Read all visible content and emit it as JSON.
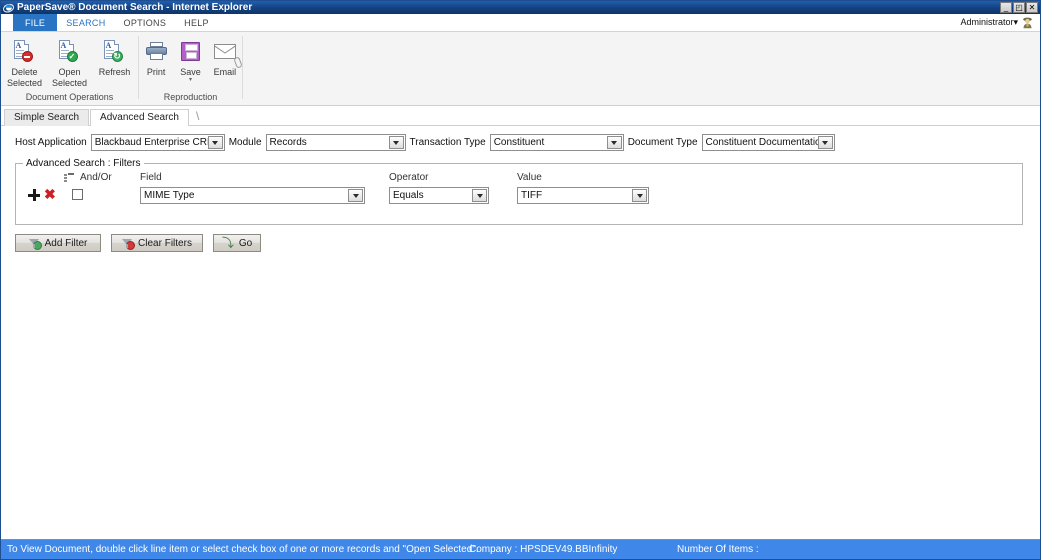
{
  "window": {
    "title": "PaperSave® Document Search - Internet Explorer",
    "icon": "ie-icon",
    "controls": [
      {
        "name": "minimize-button",
        "glyph": "_"
      },
      {
        "name": "restore-button",
        "glyph": "◰"
      },
      {
        "name": "close-button",
        "glyph": "✕"
      }
    ]
  },
  "menubar": {
    "file_label": "FILE",
    "items": [
      {
        "label": "SEARCH",
        "active": true
      },
      {
        "label": "OPTIONS",
        "active": false
      },
      {
        "label": "HELP",
        "active": false
      }
    ],
    "user_label": "Administrator▾",
    "user_icon": "user-avatar-icon"
  },
  "ribbon": {
    "groups": [
      {
        "title": "Document Operations",
        "buttons": [
          {
            "label": "Delete\nSelected",
            "icon": "document-delete-icon",
            "dropdown": false
          },
          {
            "label": "Open\nSelected",
            "icon": "document-open-icon",
            "dropdown": false
          },
          {
            "label": "Refresh",
            "icon": "document-refresh-icon",
            "dropdown": false
          }
        ]
      },
      {
        "title": "Reproduction",
        "buttons": [
          {
            "label": "Print",
            "icon": "printer-icon",
            "dropdown": false
          },
          {
            "label": "Save",
            "icon": "floppy-disk-icon",
            "dropdown": true,
            "caret": "▾"
          },
          {
            "label": "Email",
            "icon": "envelope-attachment-icon",
            "dropdown": false
          }
        ]
      }
    ]
  },
  "tabs": [
    {
      "label": "Simple Search",
      "active": false
    },
    {
      "label": "Advanced Search",
      "active": true
    }
  ],
  "tab_tail": "\\",
  "search_criteria": [
    {
      "label": "Host Application",
      "value": "Blackbaud Enterprise CRM",
      "name": "host-application"
    },
    {
      "label": "Module",
      "value": "Records",
      "name": "module"
    },
    {
      "label": "Transaction Type",
      "value": "Constituent",
      "name": "transaction-type"
    },
    {
      "label": "Document Type",
      "value": "Constituent Documentation",
      "name": "document-type"
    }
  ],
  "filters": {
    "group_title": "Advanced Search : Filters",
    "columns": {
      "list_icon": "filter-list-icon",
      "andor": "And/Or",
      "field": "Field",
      "operator": "Operator",
      "value": "Value"
    },
    "rows": [
      {
        "add_icon": "add-filter-row-icon",
        "delete_icon": "delete-filter-row-icon",
        "checked": false,
        "andor": "",
        "field": "MIME Type",
        "operator": "Equals",
        "value": "TIFF"
      }
    ]
  },
  "actions": [
    {
      "label": "Add Filter",
      "icon": "funnel-add-icon",
      "name": "add-filter-button"
    },
    {
      "label": "Clear Filters",
      "icon": "funnel-clear-icon",
      "name": "clear-filters-button"
    },
    {
      "label": "Go",
      "icon": "go-arrow-icon",
      "name": "go-button"
    }
  ],
  "statusbar": {
    "message": "To View Document, double click line item or select check box of one or more records and \"Open Selected\".",
    "company": "Company : HPSDEV49.BBInfinity",
    "item_count": "Number Of Items :"
  },
  "colors": {
    "titlebar": "#14417e",
    "accent": "#2a74c4",
    "statusbar": "#3f87e8",
    "ribbon_bg": "#f4f4f4"
  }
}
